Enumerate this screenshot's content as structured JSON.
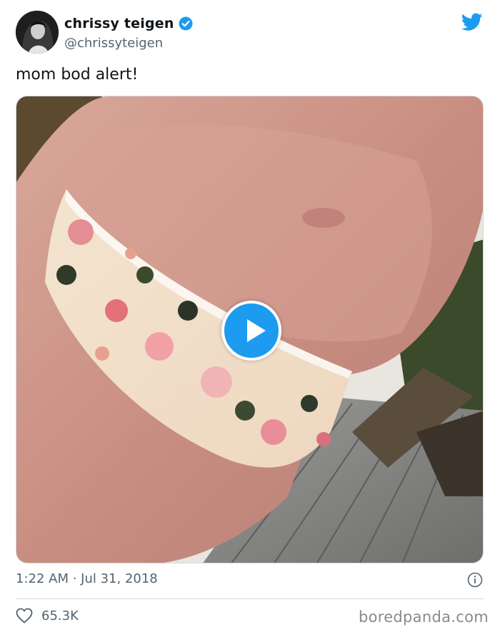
{
  "author": {
    "display_name": "chrissy teigen",
    "handle": "@chrissyteigen",
    "verified": true
  },
  "tweet": {
    "text": "mom bod alert!",
    "timestamp": "1:22 AM · Jul 31, 2018",
    "likes": "65.3K"
  },
  "media": {
    "type": "video",
    "description_icon": "play-icon"
  },
  "watermark": "boredpanda.com",
  "colors": {
    "twitter_blue": "#1d9bf0",
    "text_primary": "#0f1419",
    "text_secondary": "#536471",
    "divider": "#cfd9de"
  }
}
